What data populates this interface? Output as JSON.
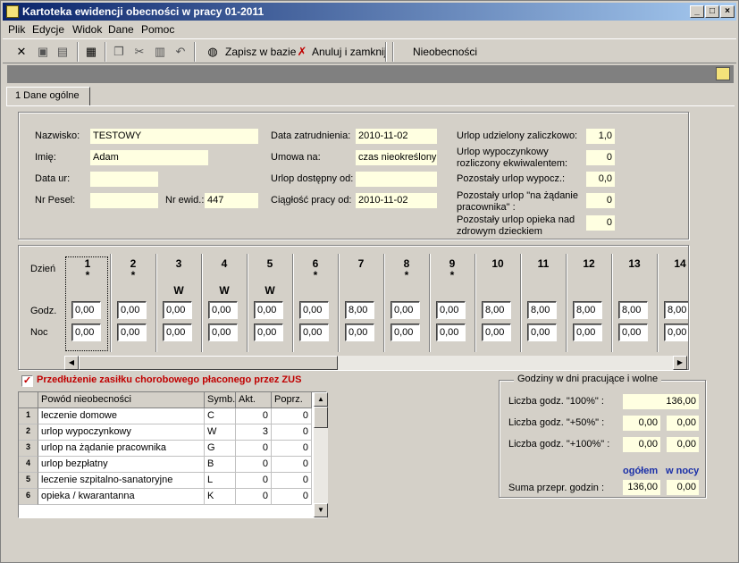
{
  "window": {
    "title": "Kartoteka ewidencji obecności w pracy 01-2011",
    "controls": [
      "_",
      "□",
      "×"
    ]
  },
  "menu": [
    "Plik",
    "Edycje",
    "Widok",
    "Dane",
    "Pomoc"
  ],
  "toolbar": {
    "save_label": "Zapisz w bazie",
    "cancel_label": "Anuluj i zamknij",
    "absence_label": "Nieobecności"
  },
  "tab": {
    "label": "1 Dane ogólne"
  },
  "personal": {
    "nazwisko_label": "Nazwisko:",
    "nazwisko": "TESTOWY",
    "imie_label": "Imię:",
    "imie": "Adam",
    "data_ur_label": "Data ur:",
    "data_ur": "",
    "pesel_label": "Nr Pesel:",
    "pesel": "",
    "nr_ewid_label": "Nr ewid.:",
    "nr_ewid": "447"
  },
  "employment": {
    "data_zatr_label": "Data zatrudnienia:",
    "data_zatr": "2010-11-02",
    "umowa_label": "Umowa na:",
    "umowa": "czas nieokreślony",
    "urlop_od_label": "Urlop dostępny od:",
    "urlop_od": "",
    "ciaglosc_label": "Ciągłość pracy od:",
    "ciaglosc": "2010-11-02"
  },
  "leave": {
    "zaliczkowo_label": "Urlop udzielony zaliczkowo:",
    "zaliczkowo": "1,0",
    "ekwiwalent_label1": "Urlop wypoczynkowy",
    "ekwiwalent_label2": "rozliczony ekwiwalentem:",
    "ekwiwalent": "0",
    "pozostaly_label": "Pozostały urlop wypocz.:",
    "pozostaly": "0,0",
    "zadanie_label1": "Pozostały urlop \"na żądanie",
    "zadanie_label2": "pracownika\" :",
    "zadanie": "0",
    "opieka_label1": "Pozostały urlop opieka nad",
    "opieka_label2": "zdrowym dzieckiem",
    "opieka": "0"
  },
  "days": {
    "row_dzien": "Dzień",
    "row_godz": "Godz.",
    "row_noc": "Noc",
    "items": [
      {
        "num": "1",
        "mark": "*",
        "code": "",
        "godz": "0,00",
        "noc": "0,00"
      },
      {
        "num": "2",
        "mark": "*",
        "code": "",
        "godz": "0,00",
        "noc": "0,00"
      },
      {
        "num": "3",
        "mark": "",
        "code": "W",
        "godz": "0,00",
        "noc": "0,00"
      },
      {
        "num": "4",
        "mark": "",
        "code": "W",
        "godz": "0,00",
        "noc": "0,00"
      },
      {
        "num": "5",
        "mark": "",
        "code": "W",
        "godz": "0,00",
        "noc": "0,00"
      },
      {
        "num": "6",
        "mark": "*",
        "code": "",
        "godz": "0,00",
        "noc": "0,00"
      },
      {
        "num": "7",
        "mark": "",
        "code": "",
        "godz": "8,00",
        "noc": "0,00"
      },
      {
        "num": "8",
        "mark": "*",
        "code": "",
        "godz": "0,00",
        "noc": "0,00"
      },
      {
        "num": "9",
        "mark": "*",
        "code": "",
        "godz": "0,00",
        "noc": "0,00"
      },
      {
        "num": "10",
        "mark": "",
        "code": "",
        "godz": "8,00",
        "noc": "0,00"
      },
      {
        "num": "11",
        "mark": "",
        "code": "",
        "godz": "8,00",
        "noc": "0,00"
      },
      {
        "num": "12",
        "mark": "",
        "code": "",
        "godz": "8,00",
        "noc": "0,00"
      },
      {
        "num": "13",
        "mark": "",
        "code": "",
        "godz": "8,00",
        "noc": "0,00"
      },
      {
        "num": "14",
        "mark": "",
        "code": "",
        "godz": "8,00",
        "noc": "0,00"
      }
    ]
  },
  "zus": {
    "checked": true,
    "label": "Przedłużenie zasiłku chorobowego płaconego przez ZUS"
  },
  "absence_table": {
    "headers": [
      "Powód nieobecności",
      "Symb.",
      "Akt.",
      "Poprz."
    ],
    "rows": [
      {
        "n": "1",
        "reason": "leczenie domowe",
        "sym": "C",
        "akt": "0",
        "poprz": "0"
      },
      {
        "n": "2",
        "reason": "urlop wypoczynkowy",
        "sym": "W",
        "akt": "3",
        "poprz": "0"
      },
      {
        "n": "3",
        "reason": "urlop na żądanie pracownika",
        "sym": "G",
        "akt": "0",
        "poprz": "0"
      },
      {
        "n": "4",
        "reason": "urlop bezpłatny",
        "sym": "B",
        "akt": "0",
        "poprz": "0"
      },
      {
        "n": "5",
        "reason": "leczenie szpitalno-sanatoryjne",
        "sym": "L",
        "akt": "0",
        "poprz": "0"
      },
      {
        "n": "6",
        "reason": "opieka / kwarantanna",
        "sym": "K",
        "akt": "0",
        "poprz": "0"
      }
    ]
  },
  "hours": {
    "title": "Godziny w dni pracujące i wolne",
    "h100_label": "Liczba godz. \"100%\" :",
    "h100": "136,00",
    "h50_label": "Liczba godz. \"+50%\" :",
    "h50_a": "0,00",
    "h50_b": "0,00",
    "h100p_label": "Liczba godz. \"+100%\" :",
    "h100p_a": "0,00",
    "h100p_b": "0,00",
    "ogolem": "ogółem",
    "w_nocy": "w nocy",
    "suma_label": "Suma przepr. godzin :",
    "suma_a": "136,00",
    "suma_b": "0,00"
  }
}
